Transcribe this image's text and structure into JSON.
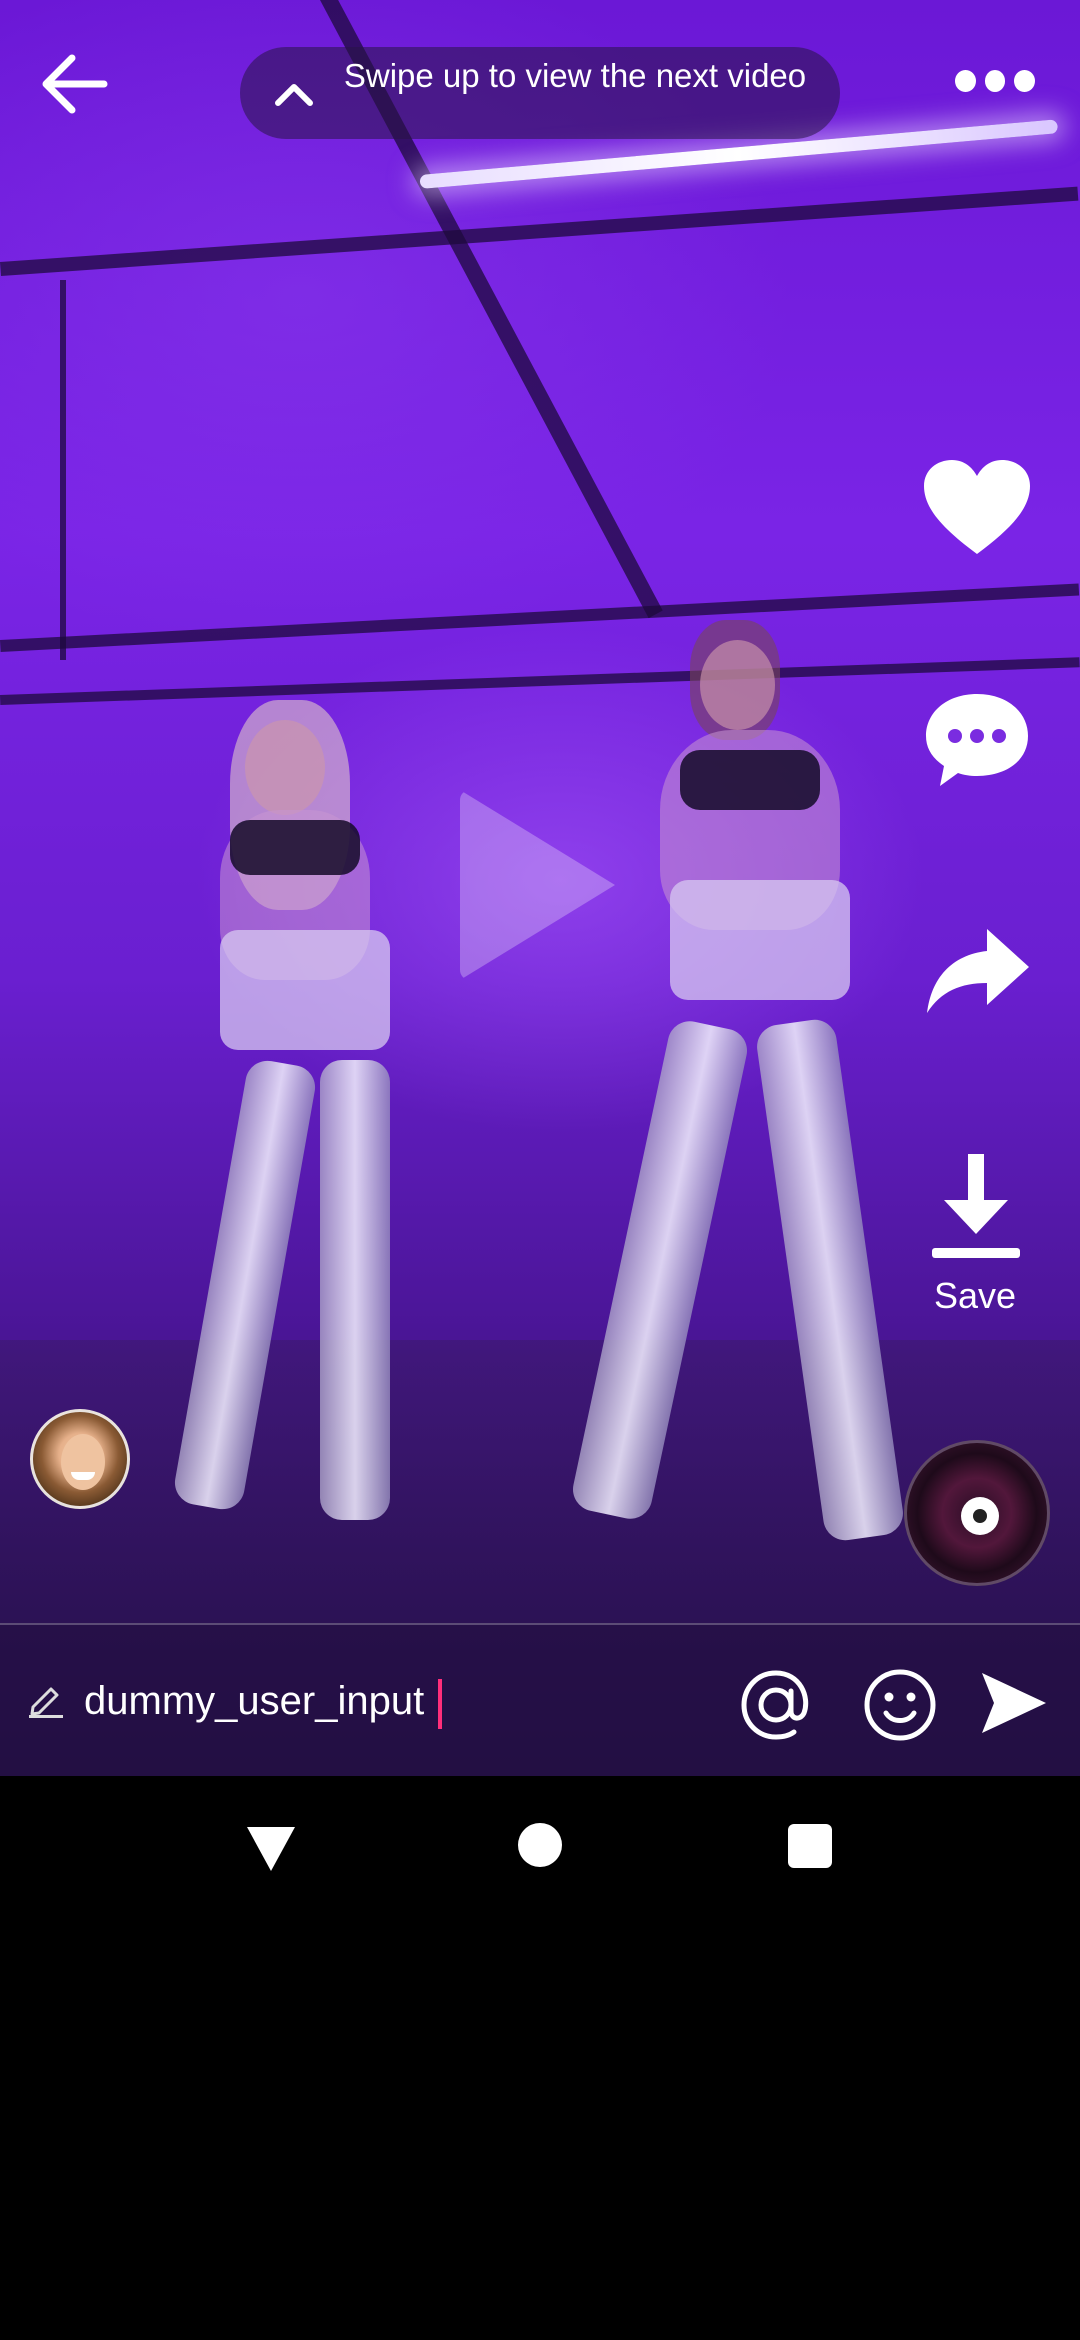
{
  "header": {
    "back_icon": "arrow-left-icon",
    "swipe_hint": "Swipe up to view the next video",
    "swipe_icon": "chevron-up-icon",
    "more_icon": "more-horizontal-icon"
  },
  "video": {
    "state_icon": "play-icon"
  },
  "rail": {
    "like_icon": "heart-icon",
    "comment_icon": "chat-bubble-icon",
    "share_icon": "share-arrow-icon",
    "save_icon": "download-icon",
    "save_label": "Save",
    "music_icon": "music-disc-icon"
  },
  "author": {
    "avatar_icon": "user-avatar"
  },
  "comment_bar": {
    "edit_icon": "pencil-icon",
    "input_value": "dummy_user_input",
    "mention_icon": "at-sign-icon",
    "emoji_icon": "smiley-icon",
    "send_icon": "send-icon"
  },
  "system_nav": {
    "back_icon": "nav-back-triangle-icon",
    "home_icon": "nav-home-circle-icon",
    "recents_icon": "nav-recents-square-icon"
  },
  "colors": {
    "caret": "#ff2e7a",
    "video_tint": "#6b18d6"
  }
}
